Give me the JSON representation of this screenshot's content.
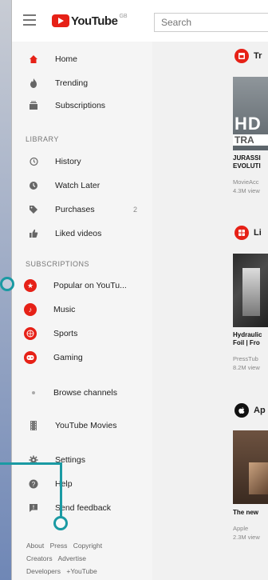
{
  "header": {
    "logo_text": "YouTube",
    "logo_region": "GB",
    "search_placeholder": "Search"
  },
  "sidebar": {
    "main_items": [
      {
        "label": "Home",
        "icon": "home-icon"
      },
      {
        "label": "Trending",
        "icon": "flame-icon"
      },
      {
        "label": "Subscriptions",
        "icon": "subscriptions-icon"
      }
    ],
    "library_heading": "LIBRARY",
    "library_items": [
      {
        "label": "History",
        "icon": "history-icon",
        "count": ""
      },
      {
        "label": "Watch Later",
        "icon": "clock-icon",
        "count": ""
      },
      {
        "label": "Purchases",
        "icon": "tag-icon",
        "count": "2"
      },
      {
        "label": "Liked videos",
        "icon": "thumbs-up-icon",
        "count": ""
      }
    ],
    "subscriptions_heading": "SUBSCRIPTIONS",
    "subscriptions": [
      {
        "label": "Popular on YouTu...",
        "color": "#e62117"
      },
      {
        "label": "Music",
        "color": "#e62117"
      },
      {
        "label": "Sports",
        "color": "#e62117"
      },
      {
        "label": "Gaming",
        "color": "#e62117"
      }
    ],
    "browse_channels": "Browse channels",
    "youtube_movies": "YouTube Movies",
    "bottom_items": [
      {
        "label": "Settings",
        "icon": "gear-icon"
      },
      {
        "label": "Help",
        "icon": "help-icon"
      },
      {
        "label": "Send feedback",
        "icon": "feedback-icon"
      }
    ],
    "footer_rows": [
      [
        "About",
        "Press",
        "Copyright"
      ],
      [
        "Creators",
        "Advertise"
      ],
      [
        "Developers",
        "+YouTube"
      ]
    ]
  },
  "main": {
    "shelves": [
      {
        "title": "Tr",
        "icon": "trending-icon",
        "icon_color": "#e62117",
        "thumb_text": "HD",
        "thumb_sub": "TRA",
        "video_title_1": "JURASSI",
        "video_title_2": "EVOLUTI",
        "channel": "MovieAcc",
        "views": "4.3M view"
      },
      {
        "title": "Li",
        "icon": "live-icon",
        "icon_color": "#e62117",
        "video_title_1": "Hydraulic",
        "video_title_2": "Foil | Fro",
        "channel": "PressTub",
        "views": "8.2M view"
      },
      {
        "title": "Ap",
        "icon": "apple-icon",
        "icon_color": "#111111",
        "video_title_1": "The new",
        "video_title_2": "",
        "channel": "Apple",
        "views": "2.3M view"
      }
    ]
  },
  "colors": {
    "accent": "#e62117",
    "annotation": "#1a9aa3"
  }
}
